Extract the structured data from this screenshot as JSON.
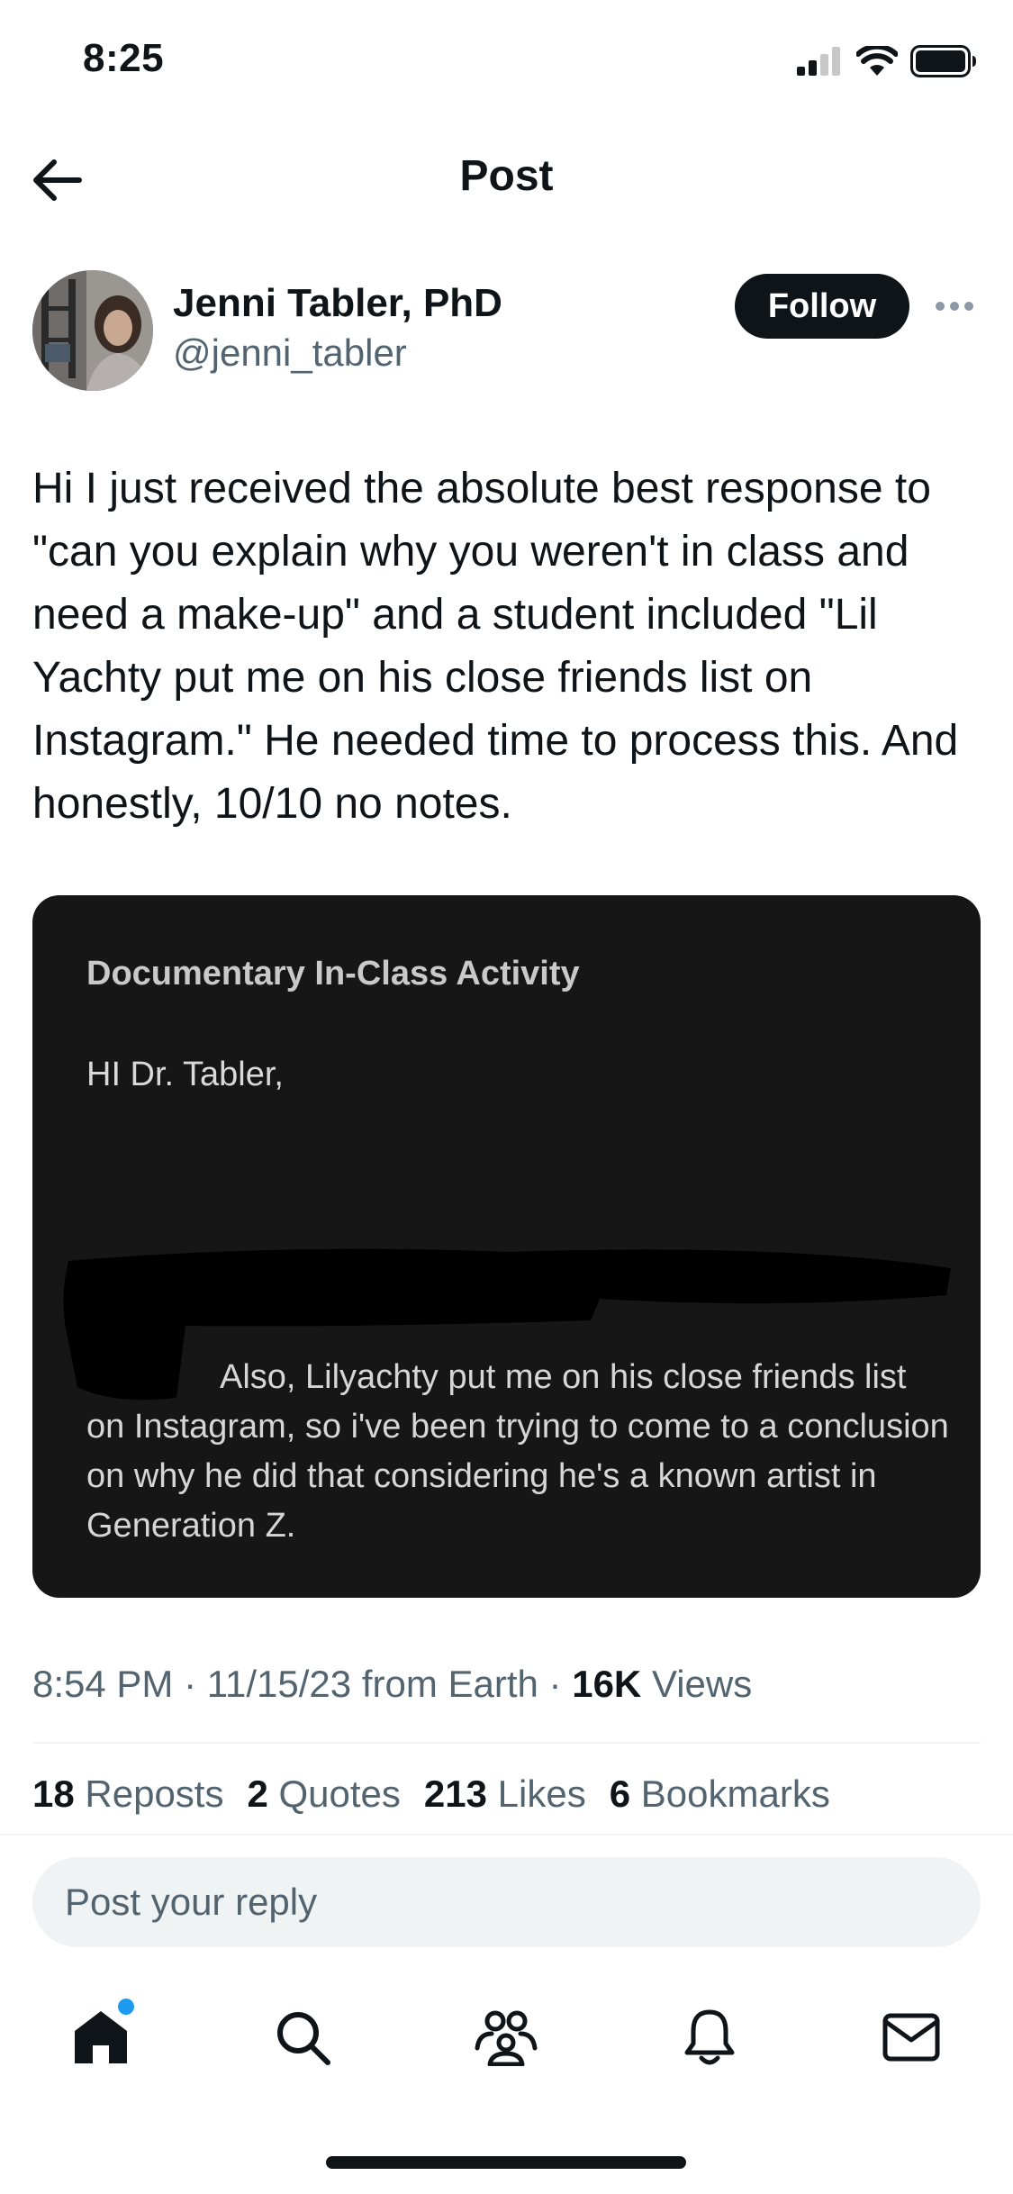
{
  "status_bar": {
    "time": "8:25"
  },
  "header": {
    "title": "Post"
  },
  "author": {
    "name": "Jenni Tabler, PhD",
    "handle": "@jenni_tabler",
    "follow_label": "Follow"
  },
  "post": {
    "text": "Hi I just received the absolute best response to \"can you explain why you weren't in class and need a make-up\" and a student included \"Lil Yachty put me on his close friends list on Instagram.\" He needed time to process this. And honestly, 10/10 no notes."
  },
  "media": {
    "subject": "Documentary In-Class Activity",
    "greeting": "HI Dr. Tabler,",
    "body": "Also, Lilyachty put me on his close friends list on Instagram, so i've been trying to come to a conclusion on why he did that considering he's a known artist in Generation Z."
  },
  "meta": {
    "time": "8:54 PM",
    "date": "11/15/23",
    "source": "from Earth",
    "views_count": "16K",
    "views_label": "Views",
    "sep": "·"
  },
  "stats": [
    {
      "count": "18",
      "label": "Reposts"
    },
    {
      "count": "2",
      "label": "Quotes"
    },
    {
      "count": "213",
      "label": "Likes"
    },
    {
      "count": "6",
      "label": "Bookmarks"
    }
  ],
  "reply": {
    "placeholder": "Post your reply"
  },
  "nav": {
    "items": [
      "home-icon",
      "search-icon",
      "communities-icon",
      "notifications-icon",
      "messages-icon"
    ],
    "accent": "#1d9bf0"
  }
}
